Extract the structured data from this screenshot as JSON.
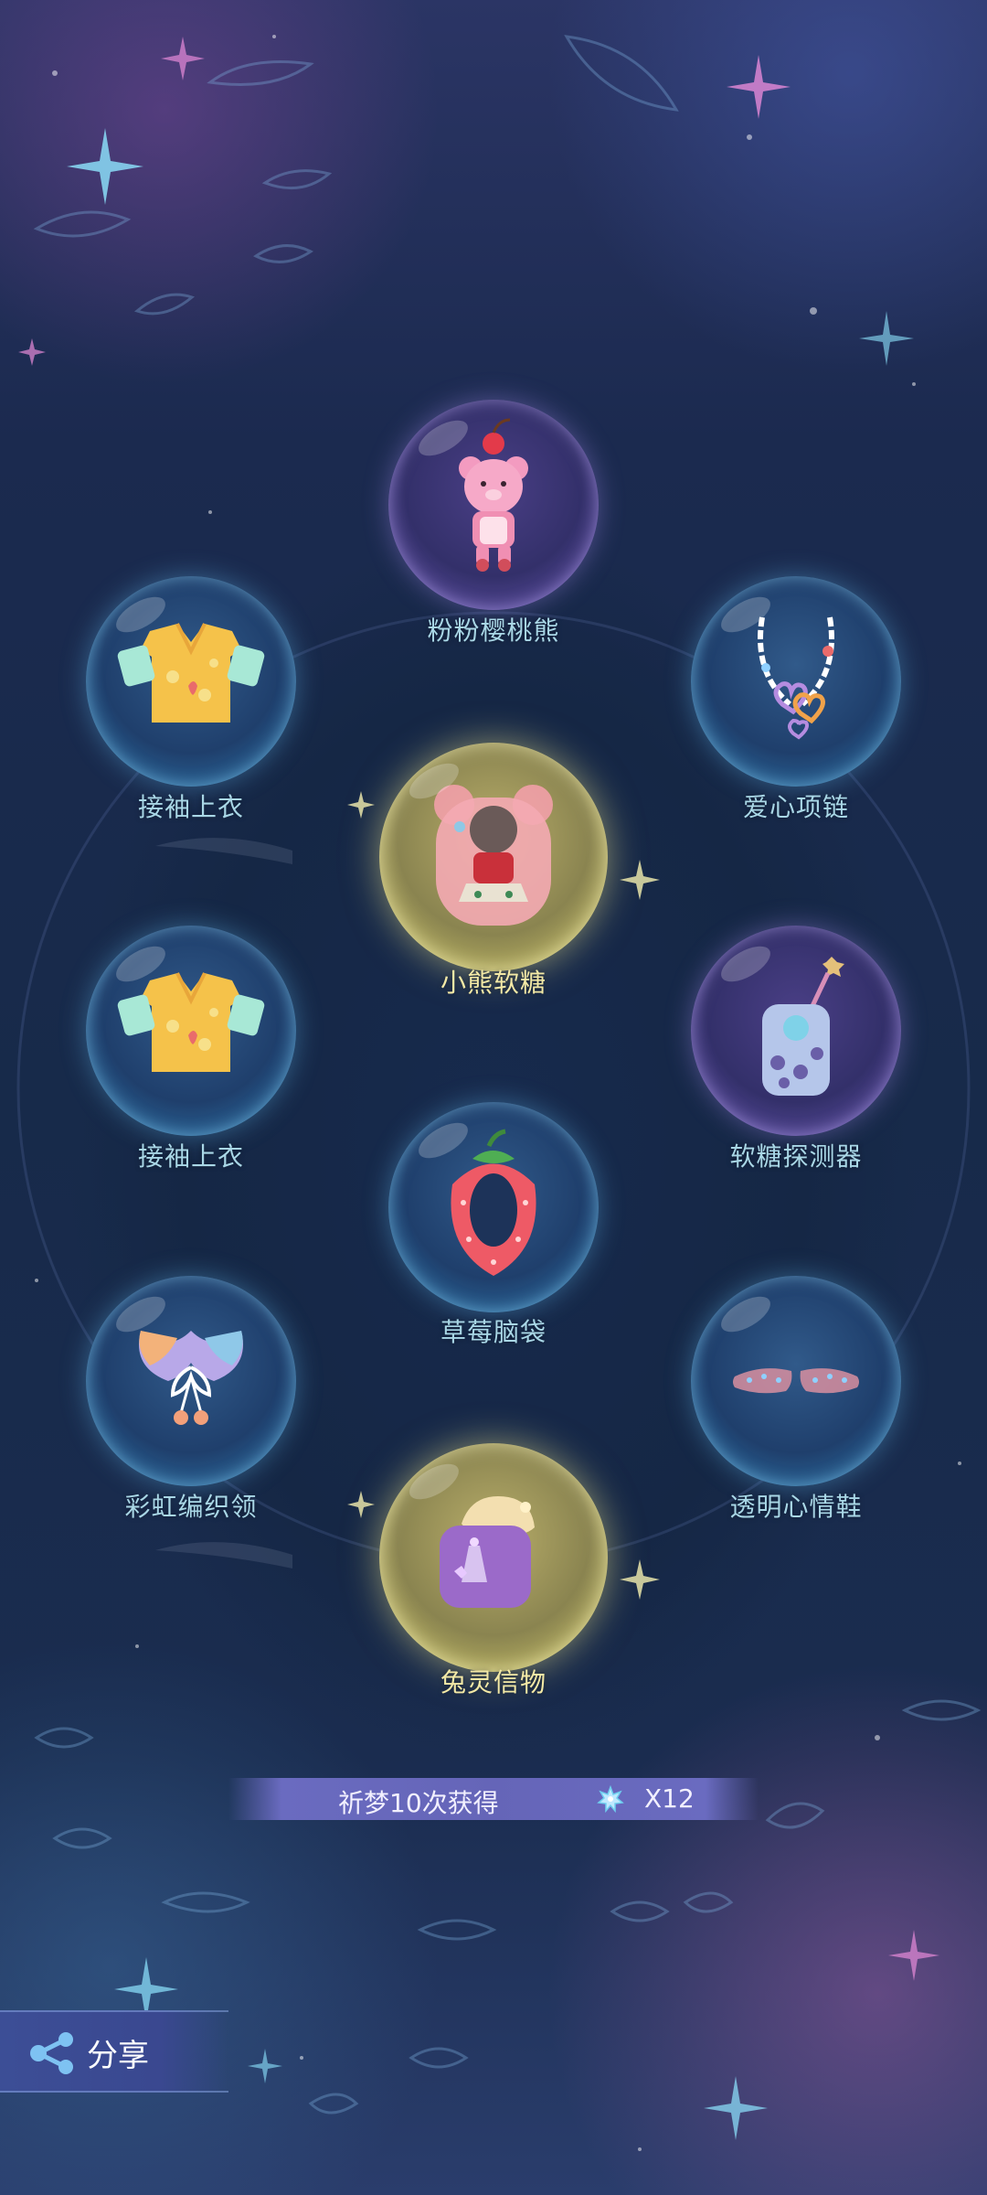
{
  "items": [
    {
      "label": "粉粉樱桃熊",
      "icon": "pink-cherry-bear-icon",
      "bubble": "purple"
    },
    {
      "label": "接袖上衣",
      "icon": "sleeve-top-icon",
      "bubble": "blue"
    },
    {
      "label": "爱心项链",
      "icon": "heart-necklace-icon",
      "bubble": "blue"
    },
    {
      "label": "小熊软糖",
      "icon": "bear-gummy-icon",
      "bubble": "gold"
    },
    {
      "label": "接袖上衣",
      "icon": "sleeve-top-icon",
      "bubble": "blue"
    },
    {
      "label": "软糖探测器",
      "icon": "gummy-detector-icon",
      "bubble": "purple"
    },
    {
      "label": "草莓脑袋",
      "icon": "strawberry-head-icon",
      "bubble": "blue"
    },
    {
      "label": "彩虹编织领",
      "icon": "rainbow-collar-icon",
      "bubble": "blue"
    },
    {
      "label": "透明心情鞋",
      "icon": "clear-mood-shoes-icon",
      "bubble": "blue"
    },
    {
      "label": "兔灵信物",
      "icon": "rabbit-token-icon",
      "bubble": "gold"
    }
  ],
  "reward_banner": {
    "text": "祈梦10次获得",
    "currency_icon": "star-crystal-icon",
    "count": "X12"
  },
  "share_button": {
    "label": "分享",
    "icon": "share-icon"
  },
  "colors": {
    "label_text": "#a9d7e6",
    "highlight_label": "#f3e9a6",
    "banner_bg": "#6565b8"
  }
}
